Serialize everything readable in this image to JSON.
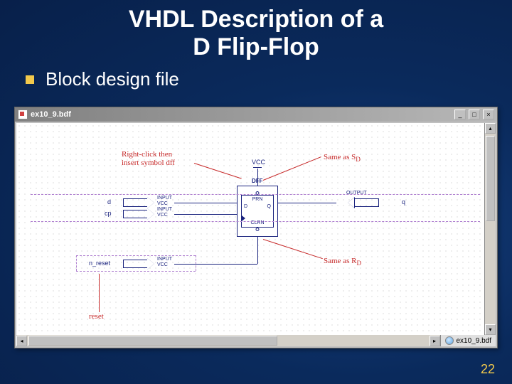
{
  "slide": {
    "title_line1": "VHDL Description of a",
    "title_line2": "D Flip-Flop",
    "bullet": "Block design file",
    "page_number": "22"
  },
  "window": {
    "title": "ex10_9.bdf",
    "min": "_",
    "max": "□",
    "close": "×",
    "tab_label": "ex10_9.bdf",
    "scroll_up": "▴",
    "scroll_down": "▾",
    "scroll_left": "◂",
    "scroll_right": "▸"
  },
  "schematic": {
    "dff_title": "DFF",
    "ports": {
      "prn": "PRN",
      "d": "D",
      "q": "Q",
      "clrn": "CLRN"
    },
    "vcc_label": "VCC",
    "signals": {
      "d": "d",
      "cp": "cp",
      "n_reset": "n_reset",
      "q": "q"
    },
    "pin_types": {
      "input1": "INPUT",
      "input_vcc1": "VCC",
      "input2": "INPUT",
      "input_vcc2": "VCC",
      "input3": "INPUT",
      "input_vcc3": "VCC",
      "output": "OUTPUT"
    },
    "annotations": {
      "right_click": "Right-click then\ninsert symbol dff",
      "same_sd": "Same as S",
      "same_sd_sub": "D",
      "same_rd": "Same as R",
      "same_rd_sub": "D",
      "reset": "reset"
    }
  }
}
